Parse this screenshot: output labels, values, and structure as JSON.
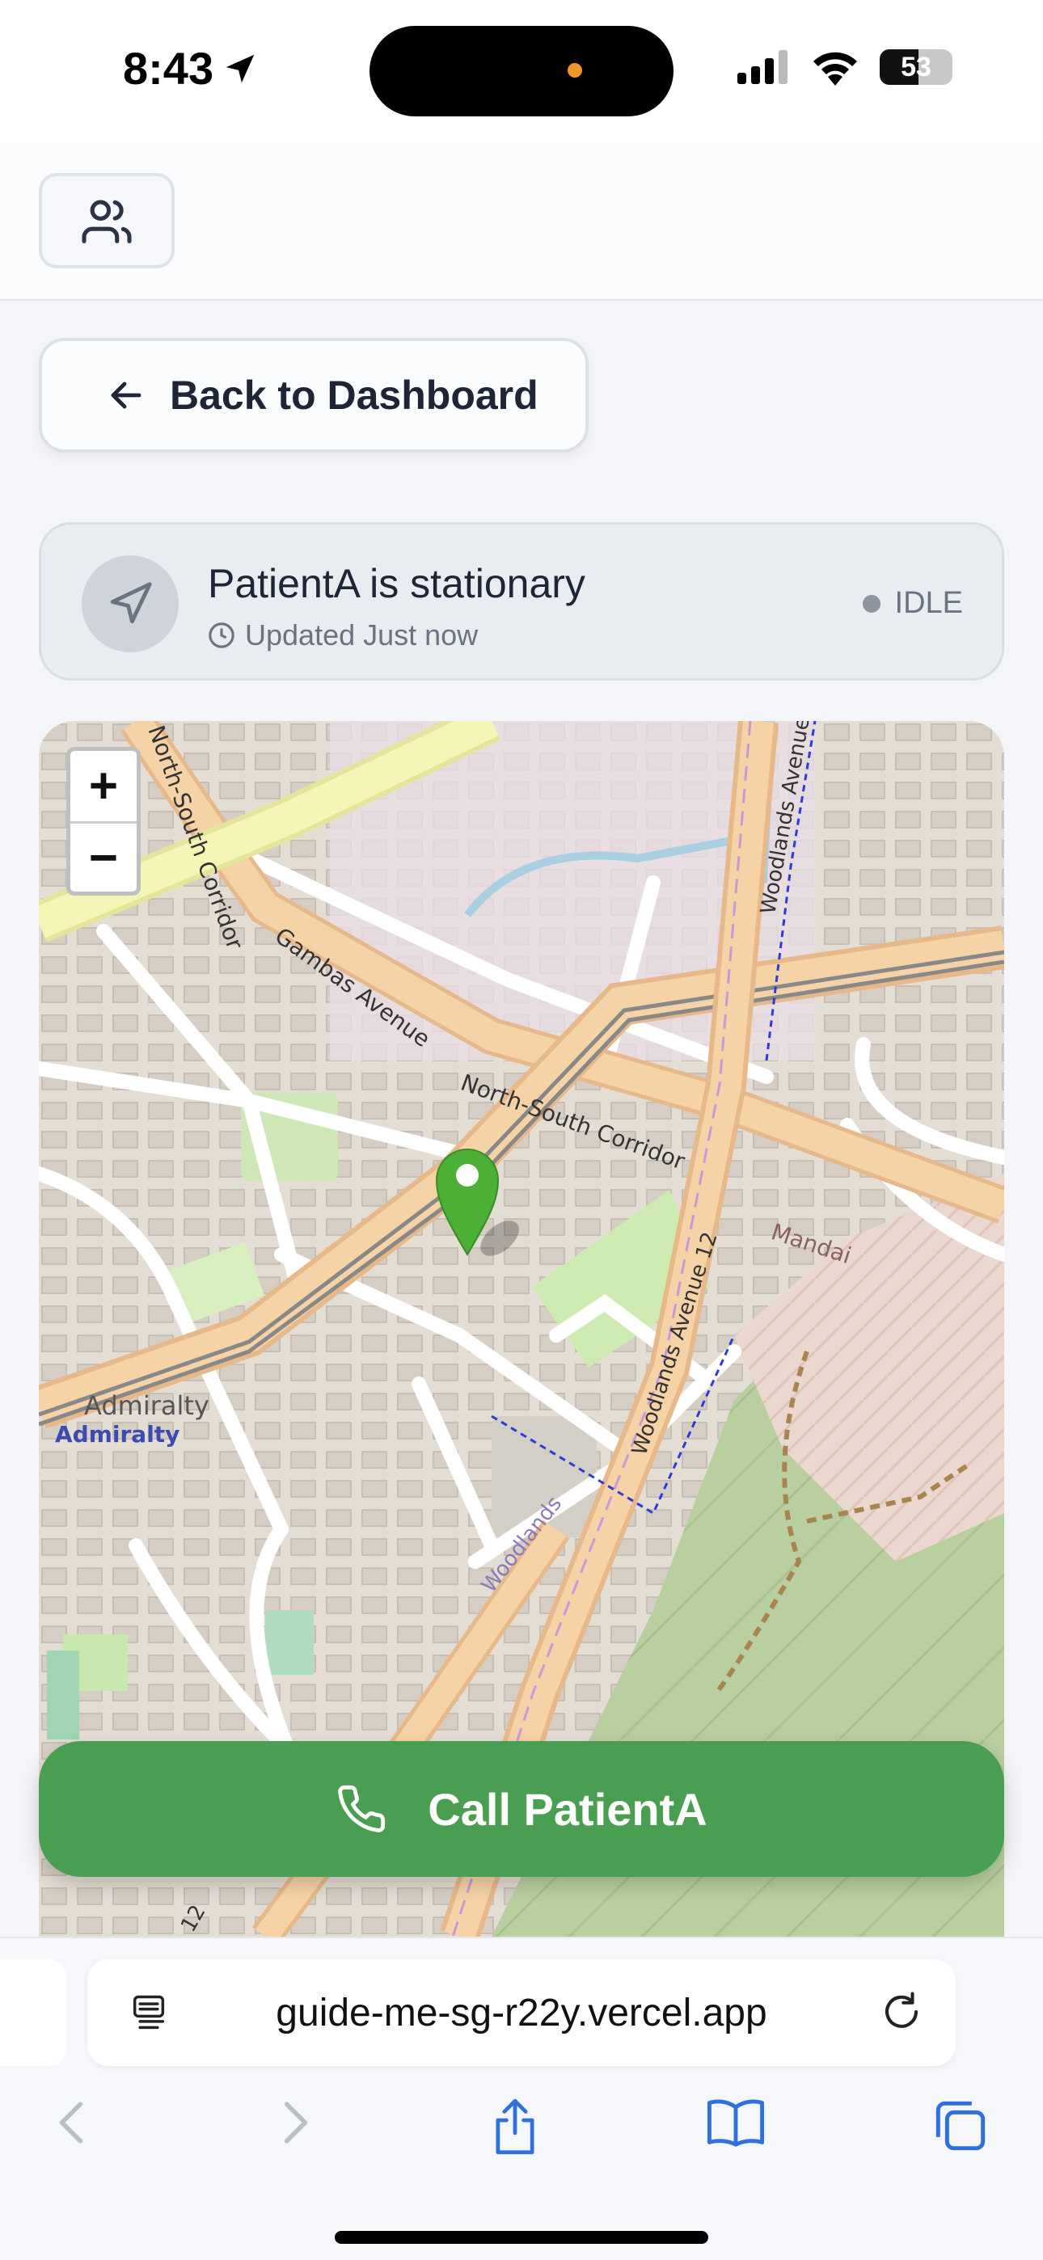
{
  "status_bar": {
    "time": "8:43",
    "battery_level": "53",
    "battery_fraction": 0.53
  },
  "header": {
    "users_icon": "users-icon"
  },
  "back_button": {
    "label": "Back to Dashboard",
    "icon": "arrow-left-icon"
  },
  "status_card": {
    "title": "PatientA is stationary",
    "updated": "Updated Just now",
    "badge": "IDLE",
    "badge_color": "#8f959e",
    "icon": "navigation-icon"
  },
  "map": {
    "zoom_in": "+",
    "zoom_out": "−",
    "labels": {
      "north_south_corridor_1": "North-South Corridor",
      "north_south_corridor_2": "North-South Corridor",
      "gambas_avenue": "Gambas Avenue",
      "woodlands_avenue": "Woodlands Avenue",
      "woodlands_avenue_12": "Woodlands Avenue 12",
      "woodlands": "Woodlands",
      "mandai": "Mandai",
      "admiralty": "Admiralty",
      "admiralty_station": "Admiralty",
      "avenue_12_fragment": "12"
    },
    "marker_color": "#4caf36"
  },
  "call_button": {
    "label": "Call PatientA",
    "icon": "phone-icon",
    "color": "#4a9e52"
  },
  "browser": {
    "url": "guide-me-sg-r22y.vercel.app"
  }
}
